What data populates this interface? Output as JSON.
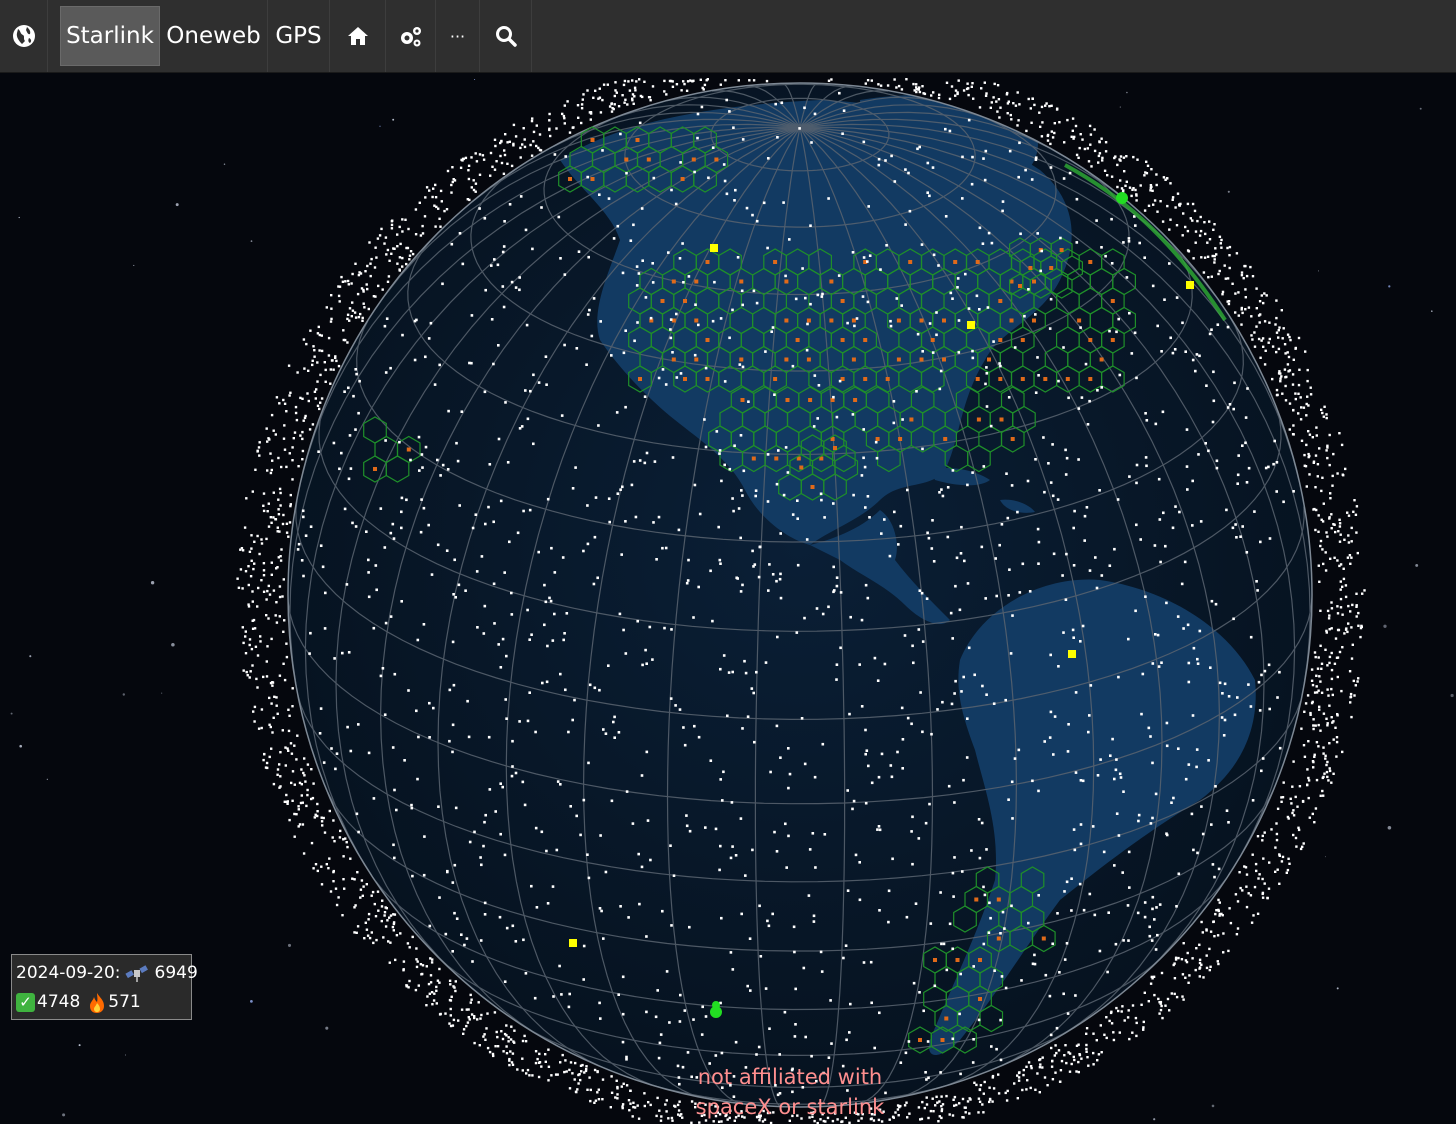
{
  "toolbar": {
    "globe_icon": "globe-icon",
    "tabs": [
      {
        "label": "Starlink",
        "active": true
      },
      {
        "label": "Oneweb",
        "active": false
      },
      {
        "label": "GPS",
        "active": false
      }
    ],
    "home_icon": "home-icon",
    "settings_icon": "gears-icon",
    "more_label": "···",
    "search_icon": "search-icon"
  },
  "stats": {
    "date": "2024-09-20:",
    "total": "6949",
    "active": "4748",
    "reentered": "571",
    "satellite_icon": "satellite-icon",
    "active_icon": "check-icon",
    "reentered_icon": "fire-icon"
  },
  "disclaimer": {
    "line1": "not affiliated with",
    "line2": "spaceX or starlink"
  },
  "colors": {
    "toolbar_bg": "#2f2f2f",
    "active_tab_bg": "#5a5a5a",
    "space_bg": "#05070d",
    "ocean": "#071a2e",
    "land": "#123a62",
    "cell_outline": "#1f8f2a",
    "satellite": "#ffffff",
    "ground_station": "#ffff00",
    "disclaimer_text": "#ff8f8f"
  }
}
